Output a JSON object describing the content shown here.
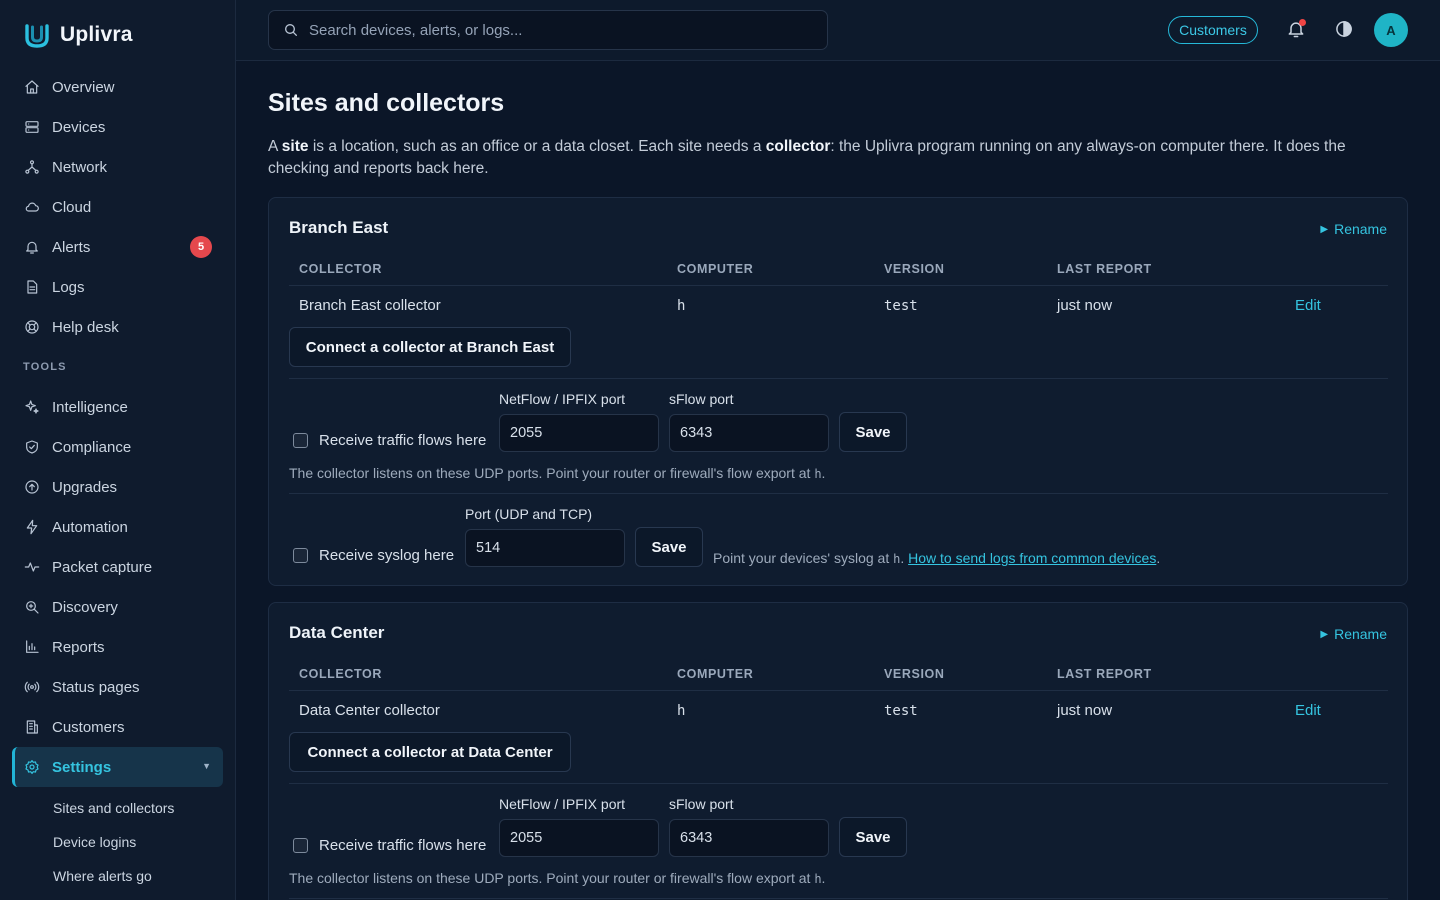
{
  "app": {
    "name": "Uplivra",
    "brand_color": "#22b4d6"
  },
  "sidebar": {
    "items": [
      {
        "label": "Overview",
        "icon": "home-icon"
      },
      {
        "label": "Devices",
        "icon": "server-icon"
      },
      {
        "label": "Network",
        "icon": "network-icon"
      },
      {
        "label": "Cloud",
        "icon": "cloud-icon"
      },
      {
        "label": "Alerts",
        "icon": "bell-icon",
        "badge": "5"
      },
      {
        "label": "Logs",
        "icon": "document-icon"
      },
      {
        "label": "Help desk",
        "icon": "lifebuoy-icon"
      }
    ],
    "tools_heading": "TOOLS",
    "tools": [
      {
        "label": "Intelligence",
        "icon": "sparkles-icon"
      },
      {
        "label": "Compliance",
        "icon": "shield-check-icon"
      },
      {
        "label": "Upgrades",
        "icon": "arrow-up-circle-icon"
      },
      {
        "label": "Automation",
        "icon": "lightning-icon"
      },
      {
        "label": "Packet capture",
        "icon": "activity-icon"
      },
      {
        "label": "Discovery",
        "icon": "search-zoom-icon"
      },
      {
        "label": "Reports",
        "icon": "bar-chart-icon"
      },
      {
        "label": "Status pages",
        "icon": "broadcast-icon"
      },
      {
        "label": "Customers",
        "icon": "building-icon"
      },
      {
        "label": "Settings",
        "icon": "gear-icon",
        "active": true,
        "expanded": true
      }
    ],
    "settings_sub": [
      {
        "label": "Sites and collectors"
      },
      {
        "label": "Device logins"
      },
      {
        "label": "Where alerts go"
      }
    ]
  },
  "topbar": {
    "search_placeholder": "Search devices, alerts, or logs...",
    "context_chip": "Customers",
    "avatar_initial": "A"
  },
  "page": {
    "title": "Sites and collectors",
    "intro": {
      "p1": "A ",
      "b1": "site",
      "p2": " is a location, such as an office or a data closet. Each site needs a ",
      "b2": "collector",
      "p3": ": the Uplivra program running on any always-on computer there. It does the checking and reports back here."
    }
  },
  "table_headers": {
    "collector": "COLLECTOR",
    "computer": "COMPUTER",
    "version": "VERSION",
    "last_report": "LAST REPORT"
  },
  "sites": [
    {
      "name": "Branch East",
      "rename": "Rename",
      "collector": {
        "name": "Branch East collector",
        "computer": "h",
        "version": "test",
        "last_report": "just now",
        "edit": "Edit"
      },
      "connect_button": "Connect a collector at Branch East",
      "flows": {
        "checkbox_label": "Receive traffic flows here",
        "checked": false,
        "netflow_label": "NetFlow / IPFIX port",
        "netflow_value": "2055",
        "sflow_label": "sFlow port",
        "sflow_value": "6343",
        "save": "Save",
        "help_prefix": "The collector listens on these UDP ports. Point your router or firewall's flow export at ",
        "help_host": "h",
        "help_suffix": "."
      },
      "syslog": {
        "checkbox_label": "Receive syslog here",
        "checked": false,
        "port_label": "Port (UDP and TCP)",
        "port_value": "514",
        "save": "Save",
        "help_prefix": "Point your devices' syslog at ",
        "help_host": "h",
        "help_sep": ". ",
        "help_link": "How to send logs from common devices",
        "help_suffix": "."
      }
    },
    {
      "name": "Data Center",
      "rename": "Rename",
      "collector": {
        "name": "Data Center collector",
        "computer": "h",
        "version": "test",
        "last_report": "just now",
        "edit": "Edit"
      },
      "connect_button": "Connect a collector at Data Center",
      "flows": {
        "checkbox_label": "Receive traffic flows here",
        "checked": false,
        "netflow_label": "NetFlow / IPFIX port",
        "netflow_value": "2055",
        "sflow_label": "sFlow port",
        "sflow_value": "6343",
        "save": "Save",
        "help_prefix": "The collector listens on these UDP ports. Point your router or firewall's flow export at ",
        "help_host": "h",
        "help_suffix": "."
      }
    }
  ]
}
